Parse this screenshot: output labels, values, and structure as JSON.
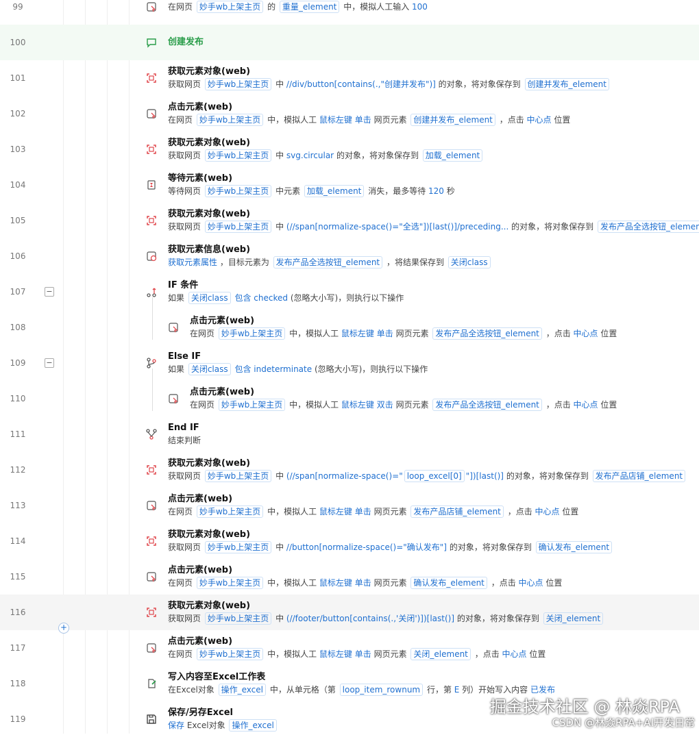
{
  "rows": [
    {
      "num": "99",
      "icon": "click-icon",
      "title": "",
      "desc": [
        {
          "t": "在网页 "
        },
        {
          "tag": "妙手wb上架主页"
        },
        {
          "t": " 的 "
        },
        {
          "tag": "重量_element"
        },
        {
          "t": " 中，模拟人工输入 "
        },
        {
          "b": "100"
        }
      ]
    },
    {
      "num": "100",
      "icon": "comment-icon",
      "title": "创建发布",
      "desc": []
    },
    {
      "num": "101",
      "icon": "get-element-icon",
      "title": "获取元素对象(web)",
      "desc": [
        {
          "t": "获取网页 "
        },
        {
          "tag": "妙手wb上架主页"
        },
        {
          "t": " 中 "
        },
        {
          "b": "//div/button[contains(.,\"创建并发布\")]"
        },
        {
          "t": " 的对象，将对象保存到 "
        },
        {
          "tag": "创建并发布_element"
        }
      ]
    },
    {
      "num": "102",
      "icon": "click-icon",
      "title": "点击元素(web)",
      "desc": [
        {
          "t": "在网页 "
        },
        {
          "tag": "妙手wb上架主页"
        },
        {
          "t": " 中，模拟人工 "
        },
        {
          "b": "鼠标左键"
        },
        {
          "t": " "
        },
        {
          "b": "单击"
        },
        {
          "t": " 网页元素 "
        },
        {
          "tag": "创建并发布_element"
        },
        {
          "t": " ，点击 "
        },
        {
          "b": "中心点"
        },
        {
          "t": " 位置"
        }
      ]
    },
    {
      "num": "103",
      "icon": "get-element-icon",
      "title": "获取元素对象(web)",
      "desc": [
        {
          "t": "获取网页 "
        },
        {
          "tag": "妙手wb上架主页"
        },
        {
          "t": " 中 "
        },
        {
          "b": "svg.circular"
        },
        {
          "t": " 的对象，将对象保存到 "
        },
        {
          "tag": "加载_element"
        }
      ]
    },
    {
      "num": "104",
      "icon": "wait-icon",
      "title": "等待元素(web)",
      "desc": [
        {
          "t": "等待网页 "
        },
        {
          "tag": "妙手wb上架主页"
        },
        {
          "t": " 中元素 "
        },
        {
          "tag": "加载_element"
        },
        {
          "t": " 消失，最多等待 "
        },
        {
          "b": "120"
        },
        {
          "t": " 秒"
        }
      ]
    },
    {
      "num": "105",
      "icon": "get-element-icon",
      "title": "获取元素对象(web)",
      "desc": [
        {
          "t": "获取网页 "
        },
        {
          "tag": "妙手wb上架主页"
        },
        {
          "t": " 中 "
        },
        {
          "b": "(//span[normalize-space()=\"全选\"])[last()]/preceding..."
        },
        {
          "t": " 的对象，将对象保存到 "
        },
        {
          "tag": "发布产品全选按钮_element"
        }
      ]
    },
    {
      "num": "106",
      "icon": "get-info-icon",
      "title": "获取元素信息(web)",
      "desc": [
        {
          "b": "获取元素属性"
        },
        {
          "t": " ，目标元素为 "
        },
        {
          "tag": "发布产品全选按钮_element"
        },
        {
          "t": " ，将结果保存到 "
        },
        {
          "tag": "关闭class"
        }
      ]
    },
    {
      "num": "107",
      "icon": "if-icon",
      "title": "IF 条件",
      "fold": "−",
      "desc": [
        {
          "t": "如果 "
        },
        {
          "tag": "关闭class"
        },
        {
          "t": " "
        },
        {
          "b": "包含"
        },
        {
          "t": " "
        },
        {
          "b": "checked"
        },
        {
          "t": " (忽略大小写)，则执行以下操作"
        }
      ]
    },
    {
      "num": "108",
      "icon": "click-icon",
      "title": "点击元素(web)",
      "ind": true,
      "desc": [
        {
          "t": "在网页 "
        },
        {
          "tag": "妙手wb上架主页"
        },
        {
          "t": " 中，模拟人工 "
        },
        {
          "b": "鼠标左键"
        },
        {
          "t": " "
        },
        {
          "b": "单击"
        },
        {
          "t": " 网页元素 "
        },
        {
          "tag": "发布产品全选按钮_element"
        },
        {
          "t": " ，点击 "
        },
        {
          "b": "中心点"
        },
        {
          "t": " 位置"
        }
      ]
    },
    {
      "num": "109",
      "icon": "else-if-icon",
      "title": "Else IF",
      "fold": "−",
      "desc": [
        {
          "t": "如果 "
        },
        {
          "tag": "关闭class"
        },
        {
          "t": " "
        },
        {
          "b": "包含"
        },
        {
          "t": " "
        },
        {
          "b": "indeterminate"
        },
        {
          "t": " (忽略大小写)，则执行以下操作"
        }
      ]
    },
    {
      "num": "110",
      "icon": "click-icon",
      "title": "点击元素(web)",
      "ind": true,
      "desc": [
        {
          "t": "在网页 "
        },
        {
          "tag": "妙手wb上架主页"
        },
        {
          "t": " 中，模拟人工 "
        },
        {
          "b": "鼠标左键"
        },
        {
          "t": " "
        },
        {
          "b": "双击"
        },
        {
          "t": " 网页元素 "
        },
        {
          "tag": "发布产品全选按钮_element"
        },
        {
          "t": " ，点击 "
        },
        {
          "b": "中心点"
        },
        {
          "t": " 位置"
        }
      ]
    },
    {
      "num": "111",
      "icon": "end-if-icon",
      "title": "End IF",
      "desc": [
        {
          "t": "结束判断"
        }
      ]
    },
    {
      "num": "112",
      "icon": "get-element-icon",
      "title": "获取元素对象(web)",
      "desc": [
        {
          "t": "获取网页 "
        },
        {
          "tag": "妙手wb上架主页"
        },
        {
          "t": " 中 "
        },
        {
          "b": "(//span[normalize-space()=\""
        },
        {
          "tag": "loop_excel[0]"
        },
        {
          "b": "\"])[last()]"
        },
        {
          "t": " 的对象，将对象保存到 "
        },
        {
          "tag": "发布产品店铺_element"
        }
      ]
    },
    {
      "num": "113",
      "icon": "click-icon",
      "title": "点击元素(web)",
      "desc": [
        {
          "t": "在网页 "
        },
        {
          "tag": "妙手wb上架主页"
        },
        {
          "t": " 中，模拟人工 "
        },
        {
          "b": "鼠标左键"
        },
        {
          "t": " "
        },
        {
          "b": "单击"
        },
        {
          "t": " 网页元素 "
        },
        {
          "tag": "发布产品店铺_element"
        },
        {
          "t": " ，点击 "
        },
        {
          "b": "中心点"
        },
        {
          "t": " 位置"
        }
      ]
    },
    {
      "num": "114",
      "icon": "get-element-icon",
      "title": "获取元素对象(web)",
      "desc": [
        {
          "t": "获取网页 "
        },
        {
          "tag": "妙手wb上架主页"
        },
        {
          "t": " 中 "
        },
        {
          "b": "//button[normalize-space()=\"确认发布\"]"
        },
        {
          "t": " 的对象，将对象保存到 "
        },
        {
          "tag": "确认发布_element"
        }
      ]
    },
    {
      "num": "115",
      "icon": "click-icon",
      "title": "点击元素(web)",
      "desc": [
        {
          "t": "在网页 "
        },
        {
          "tag": "妙手wb上架主页"
        },
        {
          "t": " 中，模拟人工 "
        },
        {
          "b": "鼠标左键"
        },
        {
          "t": " "
        },
        {
          "b": "单击"
        },
        {
          "t": " 网页元素 "
        },
        {
          "tag": "确认发布_element"
        },
        {
          "t": " ，点击 "
        },
        {
          "b": "中心点"
        },
        {
          "t": " 位置"
        }
      ]
    },
    {
      "num": "116",
      "icon": "get-element-icon",
      "title": "获取元素对象(web)",
      "desc": [
        {
          "t": "获取网页 "
        },
        {
          "tag": "妙手wb上架主页"
        },
        {
          "t": " 中 "
        },
        {
          "b": "(//footer/button[contains(.,'关闭')])[last()]"
        },
        {
          "t": " 的对象，将对象保存到 "
        },
        {
          "tag": "关闭_element"
        }
      ]
    },
    {
      "num": "117",
      "icon": "click-icon",
      "title": "点击元素(web)",
      "desc": [
        {
          "t": "在网页 "
        },
        {
          "tag": "妙手wb上架主页"
        },
        {
          "t": " 中，模拟人工 "
        },
        {
          "b": "鼠标左键"
        },
        {
          "t": " "
        },
        {
          "b": "单击"
        },
        {
          "t": " 网页元素 "
        },
        {
          "tag": "关闭_element"
        },
        {
          "t": " ，点击 "
        },
        {
          "b": "中心点"
        },
        {
          "t": " 位置"
        }
      ]
    },
    {
      "num": "118",
      "icon": "excel-write-icon",
      "title": "写入内容至Excel工作表",
      "desc": [
        {
          "t": "在Excel对象 "
        },
        {
          "tag": "操作_excel"
        },
        {
          "t": " 中，从单元格（第 "
        },
        {
          "tag": "loop_item_rownum"
        },
        {
          "t": " 行，第 "
        },
        {
          "b": "E"
        },
        {
          "t": " 列）开始写入内容 "
        },
        {
          "b": "已发布"
        }
      ]
    },
    {
      "num": "119",
      "icon": "save-icon",
      "title": "保存/另存Excel",
      "desc": [
        {
          "b": "保存"
        },
        {
          "t": " Excel对象 "
        },
        {
          "tag": "操作_excel"
        }
      ]
    }
  ],
  "add_button": "+",
  "watermark": "掘金技术社区 @ 林焱RPA",
  "watermark_sub": "CSDN @林焱RPA+AI开发日常",
  "colors": {
    "accent": "#1e6fd0",
    "icon_red": "#e0474c",
    "comment_green": "#2a9d4a"
  }
}
